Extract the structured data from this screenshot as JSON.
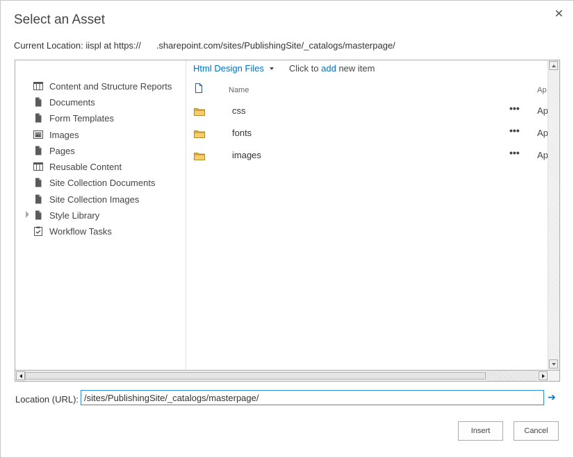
{
  "dialog": {
    "title": "Select an Asset",
    "close_glyph": "✕"
  },
  "current_location": {
    "label": "Current Location: iispl at https://",
    "path": ".sharepoint.com/sites/PublishingSite/_catalogs/masterpage/"
  },
  "tree": {
    "items": [
      {
        "label": "Content and Structure Reports",
        "icon": "list-icon"
      },
      {
        "label": "Documents",
        "icon": "document-icon"
      },
      {
        "label": "Form Templates",
        "icon": "document-icon"
      },
      {
        "label": "Images",
        "icon": "image-library-icon"
      },
      {
        "label": "Pages",
        "icon": "document-icon"
      },
      {
        "label": "Reusable Content",
        "icon": "list-icon"
      },
      {
        "label": "Site Collection Documents",
        "icon": "document-icon"
      },
      {
        "label": "Site Collection Images",
        "icon": "document-icon"
      },
      {
        "label": "Style Library",
        "icon": "document-icon",
        "expandable": true
      },
      {
        "label": "Workflow Tasks",
        "icon": "task-icon"
      }
    ]
  },
  "list": {
    "view_name": "Html Design Files",
    "cta_prefix": "Click to",
    "cta_link": "add",
    "cta_suffix": "new item",
    "columns": {
      "name": "Name",
      "app": "Ap"
    },
    "rows": [
      {
        "name": "css",
        "menu": "•••",
        "app": "Ap",
        "icon": "folder-icon"
      },
      {
        "name": "fonts",
        "menu": "•••",
        "app": "Ap",
        "icon": "folder-icon"
      },
      {
        "name": "images",
        "menu": "•••",
        "app": "Ap",
        "icon": "folder-icon"
      }
    ]
  },
  "location": {
    "label": "Location (URL):",
    "value": "/sites/PublishingSite/_catalogs/masterpage/",
    "go_glyph": "➔"
  },
  "buttons": {
    "insert": "Insert",
    "cancel": "Cancel"
  },
  "colors": {
    "link": "#0072c6",
    "input_border": "#2a8dd4"
  }
}
